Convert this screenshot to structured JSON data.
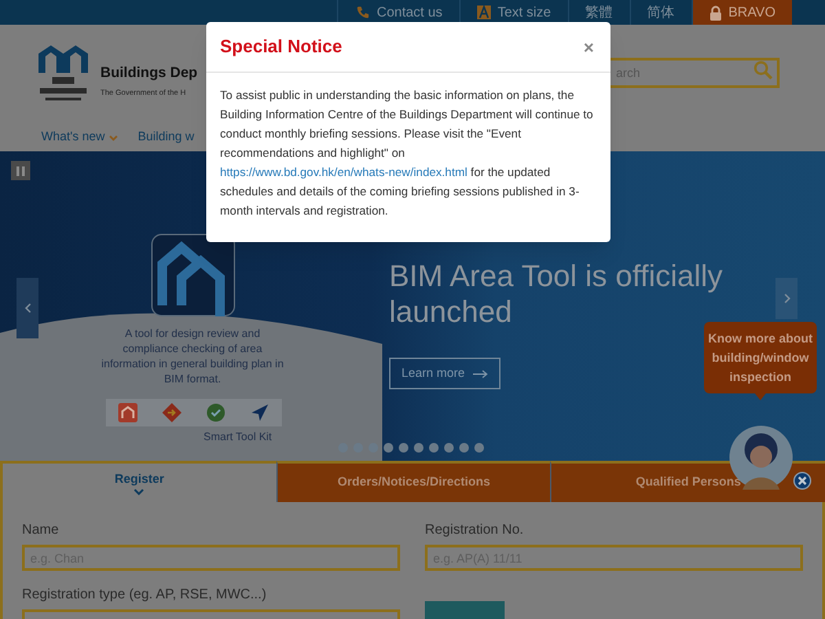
{
  "top_bar": {
    "items": [
      {
        "kind": "phone",
        "label": "Contact us"
      },
      {
        "kind": "text-size",
        "label": "Text size"
      },
      {
        "kind": "plain",
        "label": "繁體"
      },
      {
        "kind": "plain",
        "label": "简体"
      },
      {
        "kind": "lock",
        "label": "BRAVO"
      }
    ]
  },
  "header": {
    "department": "Buildings Dep",
    "subtitle": "The Government of the H",
    "search": {
      "placeholder": "arch"
    }
  },
  "nav": [
    {
      "label": "What's new",
      "kind": "dropdown"
    },
    {
      "label": "Building w",
      "kind": "link"
    }
  ],
  "hero": {
    "caption": "A tool for design review and compliance checking of area information in general building plan in BIM format.",
    "toolkit_label": "Smart Tool Kit",
    "headline": "BIM Area Tool is officially launched",
    "button": "Learn more"
  },
  "bubble": {
    "text": "Know more about building/window inspection"
  },
  "tabs": [
    {
      "label": "Register",
      "selected": true
    },
    {
      "label": "Orders/Notices/Directions",
      "selected": false
    },
    {
      "label": "Qualified Persons",
      "selected": false
    }
  ],
  "form": {
    "fields": [
      {
        "label": "Name",
        "placeholder": "e.g. Chan"
      },
      {
        "label": "Registration No.",
        "placeholder": "e.g. AP(A) 11/11"
      },
      {
        "label": "Registration type (eg. AP, RSE, MWC...)"
      }
    ]
  },
  "modal": {
    "title": "Special Notice",
    "close": "×",
    "body_before": "To assist public in understanding the basic information on plans, the Building Information Centre of the Buildings Department will continue to conduct monthly briefing sessions. Please visit the \"Event recommendations and highlight\" on ",
    "link": "https://www.bd.gov.hk/en/whats-new/index.html",
    "body_after": " for the updated schedules and details of the coming briefing sessions published in 3-month intervals and registration."
  }
}
